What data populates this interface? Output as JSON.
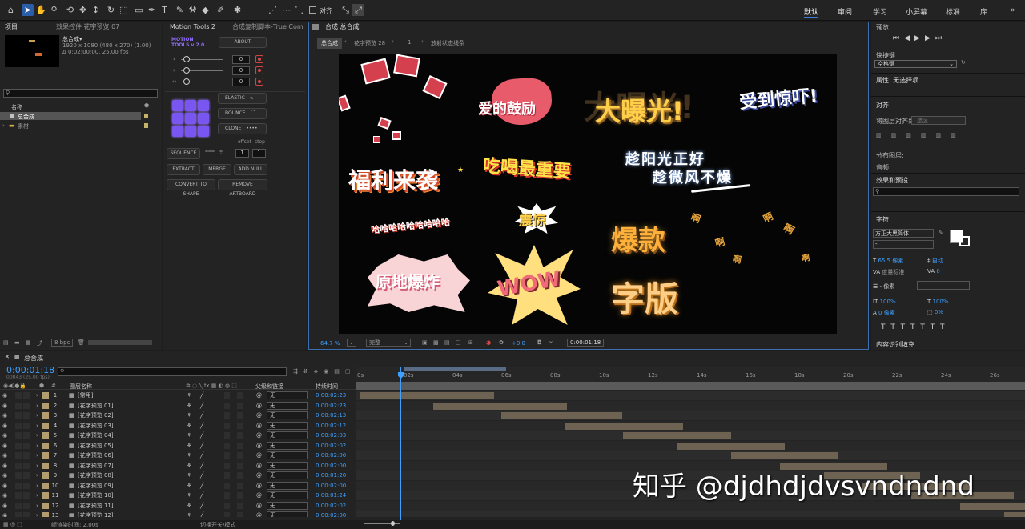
{
  "toolbar": {
    "snap_label": "对齐",
    "workspaces": [
      "默认",
      "审阅",
      "学习",
      "小屏幕",
      "标准",
      "库"
    ]
  },
  "project": {
    "tab": "项目",
    "effects_tab": "效果控件 花字预览 07",
    "comp_name": "总合成▾",
    "comp_info1": "1920 x 1080  (480 x 270)  (1.00)",
    "comp_info2": "Δ 0:02:00:00, 25.00 fps",
    "col_name": "名称",
    "items": [
      "总合成",
      "素材"
    ],
    "bpc": "8 bpc"
  },
  "motion": {
    "tab": "Motion Tools 2",
    "tab2": "合成复制脚本-True Com",
    "logo": "MOTION TOOLS v 2.0",
    "about": "ABOUT",
    "values": [
      "0",
      "0",
      "0"
    ],
    "elastic": "ELASTIC",
    "bounce": "BOUNCE",
    "clone": "CLONE",
    "offset": "offset",
    "step": "step",
    "offset_val": "1",
    "step_val": "1",
    "sequence": "SEQUENCE",
    "extract": "EXTRACT",
    "merge": "MERGE",
    "add_null": "ADD NULL",
    "convert": "CONVERT TO SHAPE",
    "remove": "REMOVE ARTBOARD"
  },
  "comp": {
    "tab": "合成 总合成",
    "crumb1": "总合成",
    "crumb2": "花字预览 28",
    "crumb3": "1",
    "crumb4": "放射状态线条",
    "zoom": "64.7 %",
    "quality": "完整",
    "exposure": "+0.0",
    "timecode": "0:00:01:18"
  },
  "stickers": {
    "s1": "爱的鼓励",
    "s2": "大曝光!",
    "s3": "受到惊吓!",
    "s4": "福利来袭",
    "s5": "吃喝最重要",
    "s6": "趁阳光正好",
    "s7": "趁微风不燥",
    "s8": "哈哈哈哈哈哈哈哈哈",
    "s9": "震惊",
    "s10": "爆款",
    "s11": "原地爆炸",
    "s12": "WOW",
    "s13": "字版",
    "s14": "啊"
  },
  "right": {
    "preview": "预览",
    "shortcut": "快捷键",
    "shortcut_val": "空格键",
    "props": "属性: 无选择项",
    "align": "对齐",
    "align_to": "将图层对齐到:",
    "align_sel": "选区",
    "distribute": "分布图层:",
    "audio": "音频",
    "effects": "效果和预设",
    "character": "字符",
    "font": "方正大黑简体",
    "size": "65.5 像素",
    "leading": "自动",
    "kerning": "度量标准",
    "tracking": "0",
    "indent": "- 像素",
    "vscale": "100%",
    "hscale": "100%",
    "baseline": "0 像素",
    "tsume": "0%",
    "para": "内容识别填充"
  },
  "timeline": {
    "tab": "总合成",
    "timecode": "0:00:01:18",
    "frames": "00043 (25.00 fps)",
    "col_name": "图层名称",
    "col_parent": "父级和链接",
    "col_dur": "持续时间",
    "ticks": [
      "0s",
      "02s",
      "04s",
      "06s",
      "08s",
      "10s",
      "12s",
      "14s",
      "16s",
      "18s",
      "20s",
      "22s",
      "24s",
      "26s"
    ],
    "layers": [
      {
        "n": "1",
        "name": "[常用]",
        "p": "无",
        "d": "0:00:02:23"
      },
      {
        "n": "2",
        "name": "[花字预览 01]",
        "p": "无",
        "d": "0:00:02:23"
      },
      {
        "n": "3",
        "name": "[花字预览 02]",
        "p": "无",
        "d": "0:00:02:13"
      },
      {
        "n": "4",
        "name": "[花字预览 03]",
        "p": "无",
        "d": "0:00:02:12"
      },
      {
        "n": "5",
        "name": "[花字预览 04]",
        "p": "无",
        "d": "0:00:02:03"
      },
      {
        "n": "6",
        "name": "[花字预览 05]",
        "p": "无",
        "d": "0:00:02:02"
      },
      {
        "n": "7",
        "name": "[花字预览 06]",
        "p": "无",
        "d": "0:00:02:00"
      },
      {
        "n": "8",
        "name": "[花字预览 07]",
        "p": "无",
        "d": "0:00:02:00"
      },
      {
        "n": "9",
        "name": "[花字预览 08]",
        "p": "无",
        "d": "0:00:01:20"
      },
      {
        "n": "10",
        "name": "[花字预览 09]",
        "p": "无",
        "d": "0:00:02:00"
      },
      {
        "n": "11",
        "name": "[花字预览 10]",
        "p": "无",
        "d": "0:00:01:24"
      },
      {
        "n": "12",
        "name": "[花字预览 11]",
        "p": "无",
        "d": "0:00:02:02"
      },
      {
        "n": "13",
        "name": "[花字预览 12]",
        "p": "无",
        "d": "0:00:02:00"
      }
    ],
    "bottom_left": "帧渲染时间: 2.00s",
    "bottom_mid": "切换开关/模式"
  },
  "watermark": "知乎 @djdhdjdvsvndndnd"
}
